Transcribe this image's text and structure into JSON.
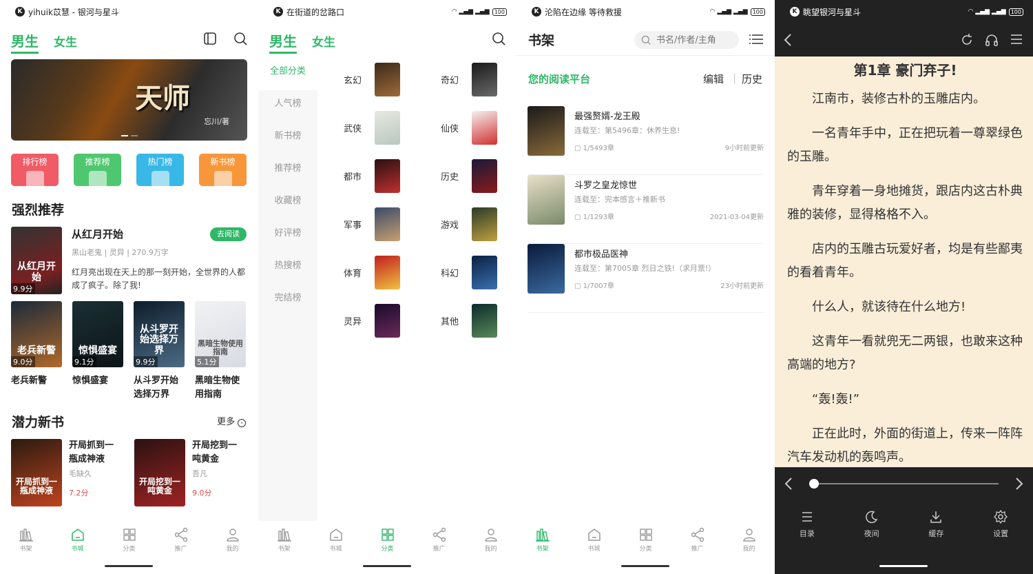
{
  "colors": {
    "brand_green": "#2fb768",
    "score_red": "#e0484e",
    "reader_bg": "#faeed9",
    "dark_bar": "#222222"
  },
  "s1": {
    "status_title": "yihuik苡慧 - 银河与星斗",
    "tab_male": "男生",
    "tab_female": "女生",
    "banner": {
      "title": "天师",
      "author": "忘川/著"
    },
    "rank_buttons": [
      {
        "label": "排行榜",
        "color": "#f05b66"
      },
      {
        "label": "推荐榜",
        "color": "#4fc771"
      },
      {
        "label": "热门榜",
        "color": "#37b8e6"
      },
      {
        "label": "新书榜",
        "color": "#f7973a"
      }
    ],
    "strong_rec_title": "强烈推荐",
    "featured": {
      "name": "从红月开始",
      "meta": "黑山老鬼 | 灵异 | 270.9万字",
      "desc": "红月亮出现在天上的那一刻开始，全世界的人都成了疯子。除了我!",
      "score": "9.9分",
      "cover_text": "从红月开始",
      "read_btn": "去阅读"
    },
    "grid": [
      {
        "name": "老兵新警",
        "score": "9.0分",
        "cover_text": "老兵新警",
        "c1": "#1c2a3a",
        "c2": "#b06a2a"
      },
      {
        "name": "惊惧盛宴",
        "score": "9.1分",
        "cover_text": "惊惧盛宴",
        "c1": "#1a2f35",
        "c2": "#0d1517"
      },
      {
        "name": "从斗罗开始选择万界",
        "score": "9.9分",
        "cover_text": "从斗罗开始选择万界",
        "c1": "#0d1d2b",
        "c2": "#4d6b85"
      },
      {
        "name": "黑暗生物使用指南",
        "score": "5.1分",
        "cover_text": "黑暗生物使用指南",
        "c1": "#f2f2f4",
        "c2": "#d8dbe3"
      }
    ],
    "potential_title": "潜力新书",
    "more": "更多",
    "new_books": [
      {
        "name": "开局抓到一瓶成神液",
        "author": "毛缺久",
        "score": "7.2分",
        "cover_text": "开局抓到一瓶成神液",
        "c1": "#2a1b10",
        "c2": "#c0431f"
      },
      {
        "name": "开局挖到一吨黄金",
        "author": "吾凡",
        "score": "9.0分",
        "cover_text": "开局挖到一吨黄金",
        "c1": "#2b1212",
        "c2": "#a02323"
      }
    ]
  },
  "s2": {
    "status_title": "在街道的岔路口",
    "tab_male": "男生",
    "tab_female": "女生",
    "side": [
      "全部分类",
      "人气榜",
      "新书榜",
      "推荐榜",
      "收藏榜",
      "好评榜",
      "热搜榜",
      "完结榜"
    ],
    "categories": [
      {
        "name": "玄幻",
        "c1": "#3a2a1a",
        "c2": "#a06a3a"
      },
      {
        "name": "奇幻",
        "c1": "#1a1a1a",
        "c2": "#6a6a6a"
      },
      {
        "name": "武侠",
        "c1": "#e8e8e0",
        "c2": "#b8c8c0"
      },
      {
        "name": "仙侠",
        "c1": "#f5f0f0",
        "c2": "#d03030"
      },
      {
        "name": "都市",
        "c1": "#2a1010",
        "c2": "#c03030"
      },
      {
        "name": "历史",
        "c1": "#1a1a3a",
        "c2": "#8a1a1a"
      },
      {
        "name": "军事",
        "c1": "#3a4a6a",
        "c2": "#c8a070"
      },
      {
        "name": "游戏",
        "c1": "#2a3a2a",
        "c2": "#c0a040"
      },
      {
        "name": "体育",
        "c1": "#c02020",
        "c2": "#f0c040"
      },
      {
        "name": "科幻",
        "c1": "#0a2040",
        "c2": "#3a70b0"
      },
      {
        "name": "灵异",
        "c1": "#1a0a2a",
        "c2": "#6a2a5a"
      },
      {
        "name": "其他",
        "c1": "#0a2a2a",
        "c2": "#5a8a5a"
      }
    ]
  },
  "s3": {
    "status_title": "沦陷在边缘 等待救援",
    "title": "书架",
    "search_placeholder": "书名/作者/主角",
    "platform": "您的阅读平台",
    "edit": "编辑",
    "history": "历史",
    "books": [
      {
        "name": "最强赘婿-龙王殿",
        "update": "连载至：第5496章：休养生息!",
        "progress": "1/5493章",
        "time": "9小时前更新",
        "c1": "#1a1a1a",
        "c2": "#8a6a3a"
      },
      {
        "name": "斗罗之皇龙惊世",
        "update": "连载至：完本感言＋推新书",
        "progress": "1/1293章",
        "time": "2021-03-04更新",
        "c1": "#e8e0c8",
        "c2": "#7a8a6a"
      },
      {
        "name": "都市极品医神",
        "update": "连载至：第7005章 烈日之铁!（求月票!）",
        "progress": "1/7007章",
        "time": "23小时前更新",
        "c1": "#0a1a3a",
        "c2": "#3a6aa0"
      }
    ]
  },
  "s4": {
    "status_title": "眺望银河与星斗",
    "chapter": "第1章 豪门弃子!",
    "paragraphs": [
      "江南市，装修古朴的玉雕店内。",
      "一名青年手中，正在把玩着一尊翠绿色的玉雕。",
      "青年穿着一身地摊货，跟店内这古朴典雅的装修，显得格格不入。",
      "店内的玉雕古玩爱好者，均是有些鄙夷的看着青年。",
      "什么人，就该待在什么地方!",
      "这青年一看就兜无二两银，也敢来这种高端的地方?",
      "“轰!轰!”",
      "正在此时，外面的街道上，传来一阵阵汽车发动机的轰鸣声。"
    ],
    "progress": 0.0,
    "tools": [
      "目录",
      "夜间",
      "缓存",
      "设置"
    ]
  },
  "nav": [
    "书架",
    "书城",
    "分类",
    "推广",
    "我的"
  ]
}
